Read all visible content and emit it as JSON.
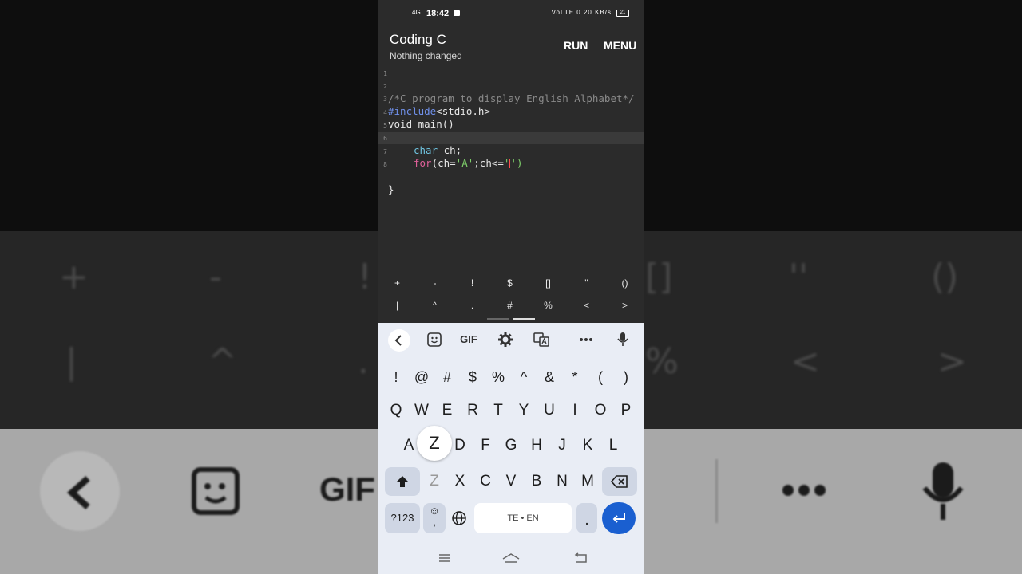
{
  "status": {
    "time": "18:42",
    "network": "4G",
    "right_indicators": "VoLTE 0.20 KB/s",
    "battery": "21"
  },
  "appbar": {
    "title": "Coding C",
    "subtitle": "Nothing changed",
    "run": "RUN",
    "menu": "MENU"
  },
  "editor": {
    "line_numbers": [
      "1",
      "2",
      "3",
      "4",
      "5",
      "6",
      "7",
      "8"
    ],
    "line1": "/*C program to display English Alphabet*/",
    "line2_directive": "#include",
    "line2_header": "<stdio.h>",
    "line3": "void main()",
    "line4": "{",
    "line5_type": "char",
    "line5_rest": " ch;",
    "line6_kw": "for",
    "line6_a": "(ch=",
    "line6_str": "'A'",
    "line6_b": ";ch<=",
    "line6_str2": "'",
    "line6_str3": "')",
    "line8": "}"
  },
  "symbols_row1": [
    "+",
    "-",
    "!",
    "$",
    "[]",
    "''",
    "()"
  ],
  "symbols_row2": [
    "|",
    "^",
    ".",
    "#",
    "%",
    "<",
    ">"
  ],
  "keyboard": {
    "toolbar": {
      "gif": "GIF"
    },
    "numrow": [
      "!",
      "@",
      "#",
      "$",
      "%",
      "^",
      "&",
      "*",
      "(",
      ")"
    ],
    "row1": [
      "Q",
      "W",
      "E",
      "R",
      "T",
      "Y",
      "U",
      "I",
      "O",
      "P"
    ],
    "row2": [
      "A",
      "S",
      "D",
      "F",
      "G",
      "H",
      "J",
      "K",
      "L"
    ],
    "row3": [
      "Z",
      "X",
      "C",
      "V",
      "B",
      "N",
      "M"
    ],
    "popup": "Z",
    "symbols_key": "?123",
    "emoji_comma": ",",
    "space": "TE • EN",
    "period": "."
  },
  "background": {
    "top_row": [
      "+",
      "-",
      "!",
      "[]",
      "''",
      "()"
    ],
    "bottom_row": [
      "|",
      "^",
      ".",
      "%",
      "<",
      ">"
    ],
    "gif": "GIF"
  }
}
